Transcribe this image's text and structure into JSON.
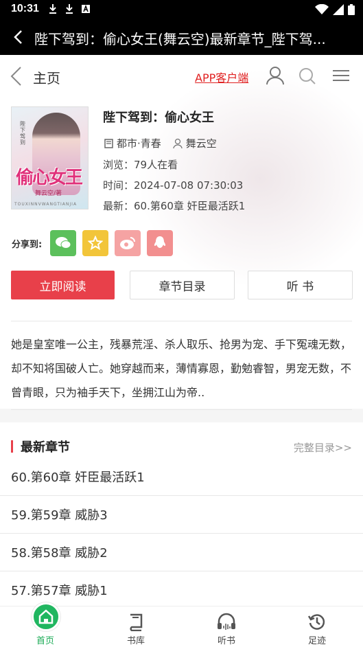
{
  "status_bar": {
    "time": "10:31"
  },
  "title_bar": {
    "title": "陛下驾到：偷心女王(舞云空)最新章节_陛下驾..."
  },
  "nav": {
    "home": "主页",
    "app_client": "APP客户端"
  },
  "cover": {
    "title": "偷心女王",
    "sub": "舞云空/著",
    "vertical": "陛下驾到",
    "pinyin": "TOUXINNVWANGTIANJIA"
  },
  "book": {
    "title": "陛下驾到：偷心女王",
    "category": "都市·青春",
    "author": "舞云空",
    "views": "浏览：79人在看",
    "time": "时间：2024-07-08 07:30:03",
    "latest": "最新：60.第60章 奸臣最活跃1"
  },
  "share": {
    "label": "分享到:",
    "colors": [
      "#5cc05c",
      "#f2c53a",
      "#f08a8a",
      "#f08a8a"
    ]
  },
  "actions": {
    "read": "立即阅读",
    "toc": "章节目录",
    "listen": "听 书"
  },
  "description": "她是皇室唯一公主，残暴荒淫、杀人取乐、抢男为宠、手下冤魂无数，却不知将国破人亡。她穿越而来，薄情寡恩，勤勉睿智，男宠无数，不曾青眼，只为袖手天下，坐拥江山为帝..",
  "latest_section": {
    "title": "最新章节",
    "more": "完整目录>>",
    "chapters": [
      "60.第60章 奸臣最活跃1",
      "59.第59章 威胁3",
      "58.第58章 威胁2",
      "57.第57章 威胁1"
    ]
  },
  "tabbar": {
    "items": [
      "首页",
      "书库",
      "听书",
      "足迹"
    ],
    "active_color": "#1aaa55"
  }
}
